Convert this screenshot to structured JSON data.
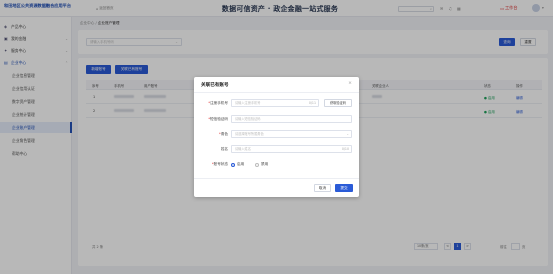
{
  "header": {
    "logo_text": "和田地区公共资源数据融合应用平台",
    "back_label": "返回首页",
    "title": "数据可信资产 · 政企金融一站式服务",
    "desk_label": "工作台"
  },
  "sidebar": {
    "items": [
      {
        "icon": "product-icon",
        "label": "产品中心"
      },
      {
        "icon": "finance-icon",
        "label": "我的金融"
      },
      {
        "icon": "service-icon",
        "label": "服务中心"
      },
      {
        "icon": "enterprise-icon",
        "label": "企业中心"
      }
    ],
    "sub_items": [
      {
        "label": "企业信息管理",
        "active": false
      },
      {
        "label": "企业信用认证",
        "active": false
      },
      {
        "label": "数字资产管理",
        "active": false
      },
      {
        "label": "企业统计管理",
        "active": false
      },
      {
        "label": "企业账户管理",
        "active": true
      },
      {
        "label": "企业角色管理",
        "active": false
      },
      {
        "label": "帮助中心",
        "active": false
      }
    ]
  },
  "breadcrumb": {
    "parent": "企业中心",
    "sep": "/",
    "current": "企业账户管理"
  },
  "filter": {
    "placeholder": "请输入手机号码",
    "search_label": "查询",
    "reset_label": "重置"
  },
  "toolbar": {
    "add_label": "新增账号",
    "import_label": "关联已有账号"
  },
  "table": {
    "headers": [
      "序号",
      "手机号",
      "用户账号",
      "账号角色",
      "关联企业人",
      "状态",
      "操作"
    ],
    "rows": [
      {
        "index": "1",
        "status": "● 启用",
        "op": "编辑"
      },
      {
        "index": "2",
        "status": "● 启用",
        "op": "编辑"
      }
    ],
    "total": "共 2 条",
    "page_size": "10条/页",
    "prev": "<",
    "page": "1",
    "next": ">",
    "jump_prefix": "前往",
    "jump_suffix": "页"
  },
  "modal": {
    "title": "关联已有账号",
    "close": "×",
    "phone_label": "注册手机号",
    "phone_placeholder": "请输入注册手机号",
    "phone_suffix": "0/11",
    "get_code_label": "获取验证码",
    "code_label": "短信验证码",
    "code_placeholder": "请输入短信验证码",
    "role_label": "角色",
    "role_placeholder": "请选择账号所属角色",
    "name_label": "姓名",
    "name_placeholder": "请输入姓名",
    "name_suffix": "0/10",
    "status_label": "账号状态",
    "enable_label": "启用",
    "disable_label": "禁用",
    "cancel_label": "取消",
    "confirm_label": "提交"
  },
  "colors": {
    "primary": "#2a5bd7",
    "success": "#1fa35c",
    "danger": "#e23c3c"
  }
}
